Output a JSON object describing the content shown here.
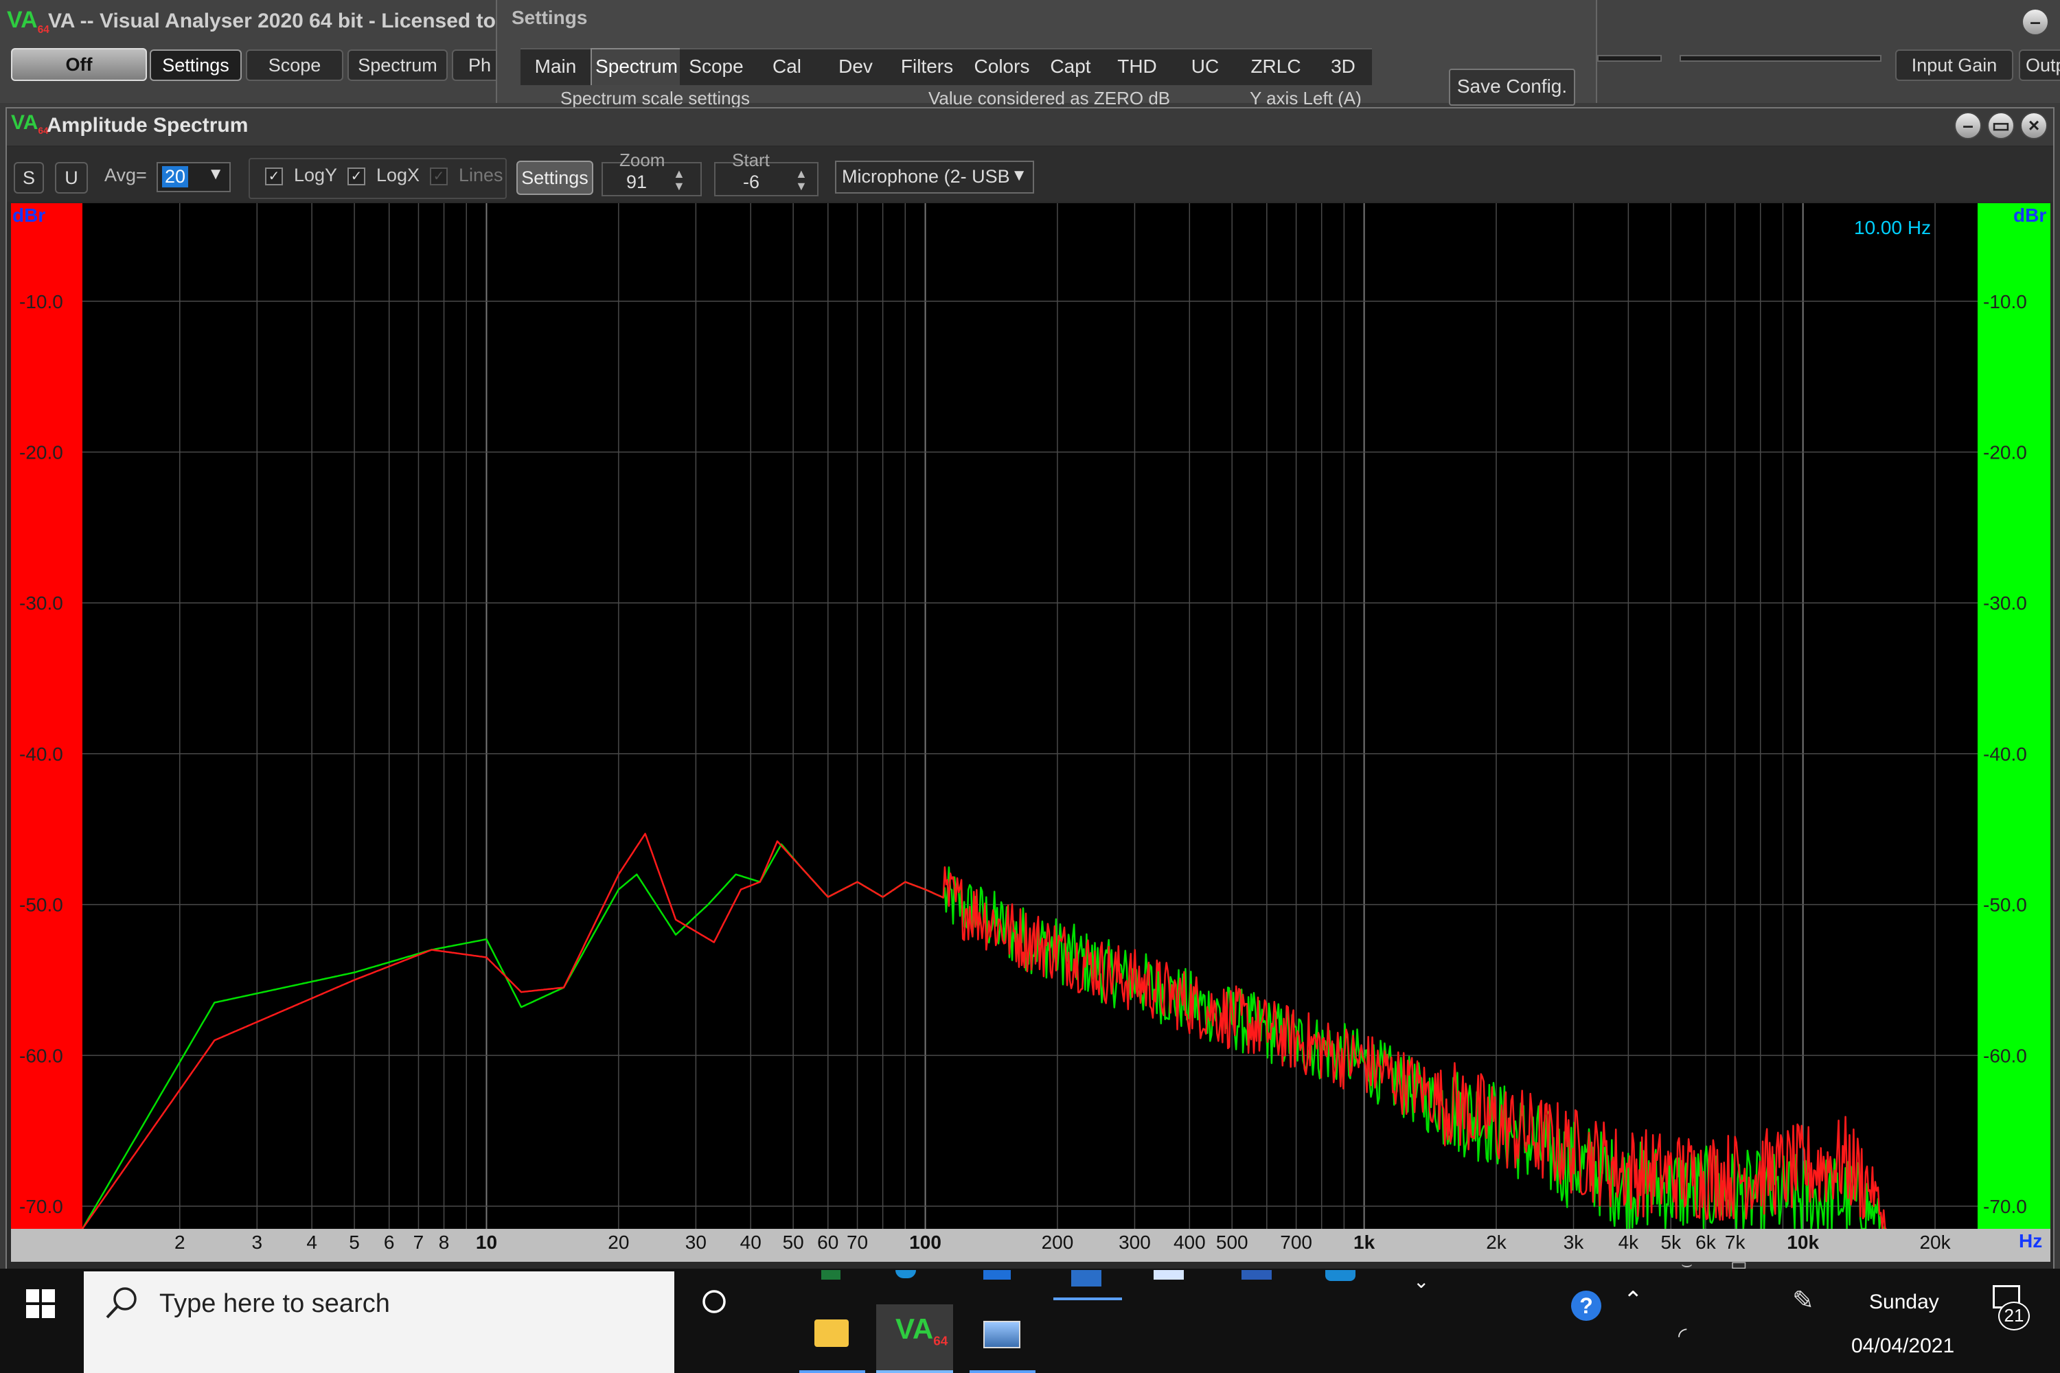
{
  "app": {
    "logo": "VA",
    "logo_sub": "64",
    "title": "VA -- Visual Analyser 2020 64 bit - Licensed to:",
    "off_label": "Off",
    "tabs": [
      "Settings",
      "Scope",
      "Spectrum",
      "Ph"
    ],
    "input_gain_label": "Input Gain",
    "output_label": "Outp"
  },
  "settings_window": {
    "title": "Settings",
    "tabs": [
      "Main",
      "Spectrum",
      "Scope",
      "Cal",
      "Dev",
      "Filters",
      "Colors",
      "Capt",
      "THD",
      "UC",
      "ZRLC",
      "3D"
    ],
    "active_tab": "Spectrum",
    "sub_labels": [
      "Spectrum scale settings",
      "Value considered as ZERO dB",
      "Y axis Left (A)"
    ],
    "save_config_label": "Save Config."
  },
  "spectrum_window": {
    "title": "Amplitude Spectrum",
    "toolbar": {
      "s_label": "S",
      "u_label": "U",
      "avg_label": "Avg=",
      "avg_value": "20",
      "logy_label": "LogY",
      "logx_label": "LogX",
      "lines_label": "Lines",
      "settings_label": "Settings",
      "zoom_label": "Zoom",
      "zoom_value": "91",
      "start_label": "Start",
      "start_value": "-6",
      "input_device": "Microphone (2- USB"
    },
    "freq_readout": "10.00 Hz",
    "unit_left": "dBr",
    "unit_right": "dBr",
    "x_unit": "Hz"
  },
  "chart_data": {
    "type": "line",
    "xlabel": "Hz",
    "ylabel": "dBr",
    "x_scale": "log",
    "xlim": [
      1.2,
      25000
    ],
    "ylim": [
      -71.5,
      -3.5
    ],
    "y_ticks": [
      "-10.0",
      "-20.0",
      "-30.0",
      "-40.0",
      "-50.0",
      "-60.0",
      "-70.0"
    ],
    "y_tick_values": [
      -10,
      -20,
      -30,
      -40,
      -50,
      -60,
      -70
    ],
    "x_tick_labels": [
      {
        "f": 2,
        "label": "2",
        "bold": false
      },
      {
        "f": 3,
        "label": "3",
        "bold": false
      },
      {
        "f": 4,
        "label": "4",
        "bold": false
      },
      {
        "f": 5,
        "label": "5",
        "bold": false
      },
      {
        "f": 6,
        "label": "6",
        "bold": false
      },
      {
        "f": 7,
        "label": "7",
        "bold": false
      },
      {
        "f": 8,
        "label": "8",
        "bold": false
      },
      {
        "f": 10,
        "label": "10",
        "bold": true
      },
      {
        "f": 20,
        "label": "20",
        "bold": false
      },
      {
        "f": 30,
        "label": "30",
        "bold": false
      },
      {
        "f": 40,
        "label": "40",
        "bold": false
      },
      {
        "f": 50,
        "label": "50",
        "bold": false
      },
      {
        "f": 60,
        "label": "60",
        "bold": false
      },
      {
        "f": 70,
        "label": "70",
        "bold": false
      },
      {
        "f": 100,
        "label": "100",
        "bold": true
      },
      {
        "f": 200,
        "label": "200",
        "bold": false
      },
      {
        "f": 300,
        "label": "300",
        "bold": false
      },
      {
        "f": 400,
        "label": "400",
        "bold": false
      },
      {
        "f": 500,
        "label": "500",
        "bold": false
      },
      {
        "f": 700,
        "label": "700",
        "bold": false
      },
      {
        "f": 1000,
        "label": "1k",
        "bold": true
      },
      {
        "f": 2000,
        "label": "2k",
        "bold": false
      },
      {
        "f": 3000,
        "label": "3k",
        "bold": false
      },
      {
        "f": 4000,
        "label": "4k",
        "bold": false
      },
      {
        "f": 5000,
        "label": "5k",
        "bold": false
      },
      {
        "f": 6000,
        "label": "6k",
        "bold": false
      },
      {
        "f": 7000,
        "label": "7k",
        "bold": false
      },
      {
        "f": 10000,
        "label": "10k",
        "bold": true
      },
      {
        "f": 20000,
        "label": "20k",
        "bold": false
      }
    ],
    "grid": true,
    "series": [
      {
        "color": "#00e000",
        "x": [
          1.2,
          2.4,
          5,
          7.5,
          10,
          12,
          15,
          20,
          22,
          27,
          32,
          37,
          42,
          47,
          52,
          60,
          70,
          80,
          90,
          100,
          130,
          160,
          200,
          260,
          330,
          400,
          500,
          700,
          1000,
          1400,
          2000,
          2800,
          3300,
          3800,
          5000,
          7000,
          10000,
          12500,
          14500,
          15500
        ],
        "y": [
          -71.5,
          -56.5,
          -54.5,
          -53,
          -52.3,
          -56.8,
          -55.5,
          -49,
          -48,
          -52,
          -50,
          -48,
          -48.5,
          -46,
          -47.5,
          -49.5,
          -48.5,
          -49.5,
          -48.5,
          -49,
          -50.5,
          -52,
          -53,
          -54.5,
          -55.5,
          -56.5,
          -57.5,
          -59,
          -60.5,
          -63,
          -64.5,
          -67,
          -67.5,
          -68.5,
          -68.8,
          -69.2,
          -69.5,
          -69.5,
          -70.5,
          -71.5
        ]
      },
      {
        "color": "#ff1a1a",
        "x": [
          1.2,
          2.4,
          5,
          7.5,
          10,
          12,
          15,
          20,
          23,
          27,
          33,
          38,
          42,
          46,
          52,
          60,
          70,
          80,
          90,
          100,
          130,
          160,
          200,
          260,
          330,
          400,
          500,
          700,
          1000,
          1400,
          2000,
          2800,
          3300,
          3800,
          5000,
          7000,
          10000,
          12500,
          14500,
          15500
        ],
        "y": [
          -71.5,
          -59,
          -55,
          -53,
          -53.5,
          -55.8,
          -55.5,
          -48,
          -45.3,
          -51,
          -52.5,
          -49,
          -48.5,
          -45.8,
          -47.5,
          -49.5,
          -48.5,
          -49.5,
          -48.5,
          -49,
          -50.5,
          -52,
          -53,
          -54.5,
          -55.5,
          -56.5,
          -57.5,
          -59,
          -60.5,
          -62.5,
          -64.5,
          -66,
          -66.8,
          -67.5,
          -68,
          -68,
          -67.5,
          -67,
          -69,
          -71.5
        ]
      }
    ]
  },
  "taskbar": {
    "search_placeholder": "Type here to search",
    "day": "Sunday",
    "date": "04/04/2021",
    "notification_count": "21"
  }
}
